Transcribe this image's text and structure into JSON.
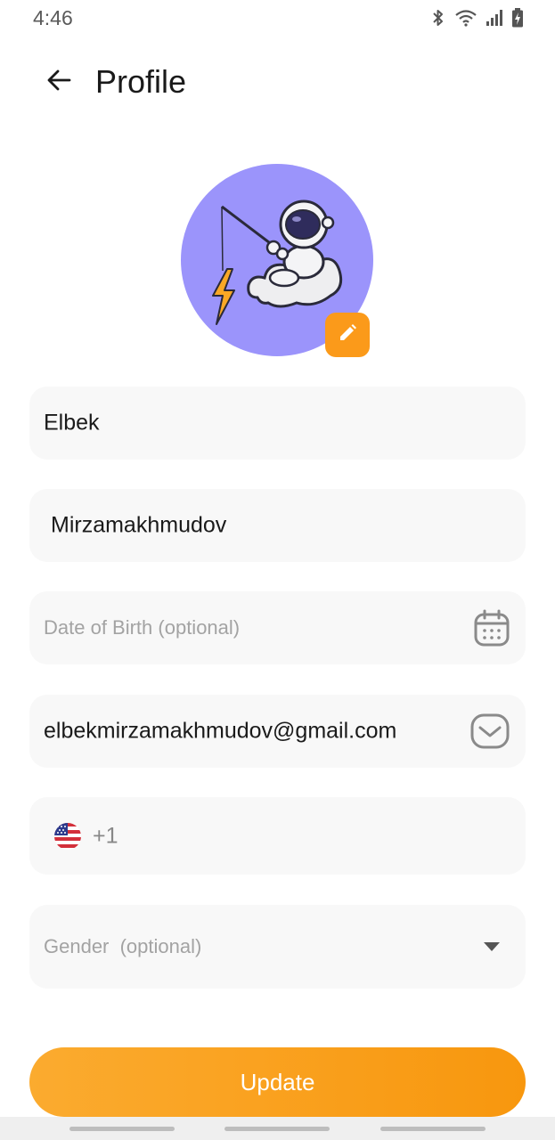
{
  "status_bar": {
    "time": "4:46"
  },
  "header": {
    "title": "Profile"
  },
  "form": {
    "first_name": "Elbek",
    "last_name": "Mirzamakhmudov",
    "dob_placeholder": "Date of Birth (optional)",
    "email": "elbekmirzamakhmudov@gmail.com",
    "phone_code": "+1",
    "gender_placeholder": "Gender  (optional)"
  },
  "actions": {
    "update_label": "Update"
  },
  "colors": {
    "accent": "#fb9a1a",
    "avatar_bg": "#9b94fb",
    "field_bg": "#f8f8f8",
    "placeholder": "#a3a3a3"
  },
  "icons": [
    "back-arrow-icon",
    "edit-pencil-icon",
    "calendar-icon",
    "mail-icon",
    "us-flag-icon",
    "dropdown-arrow-icon",
    "bluetooth-icon",
    "wifi-icon",
    "signal-icon",
    "battery-icon"
  ]
}
